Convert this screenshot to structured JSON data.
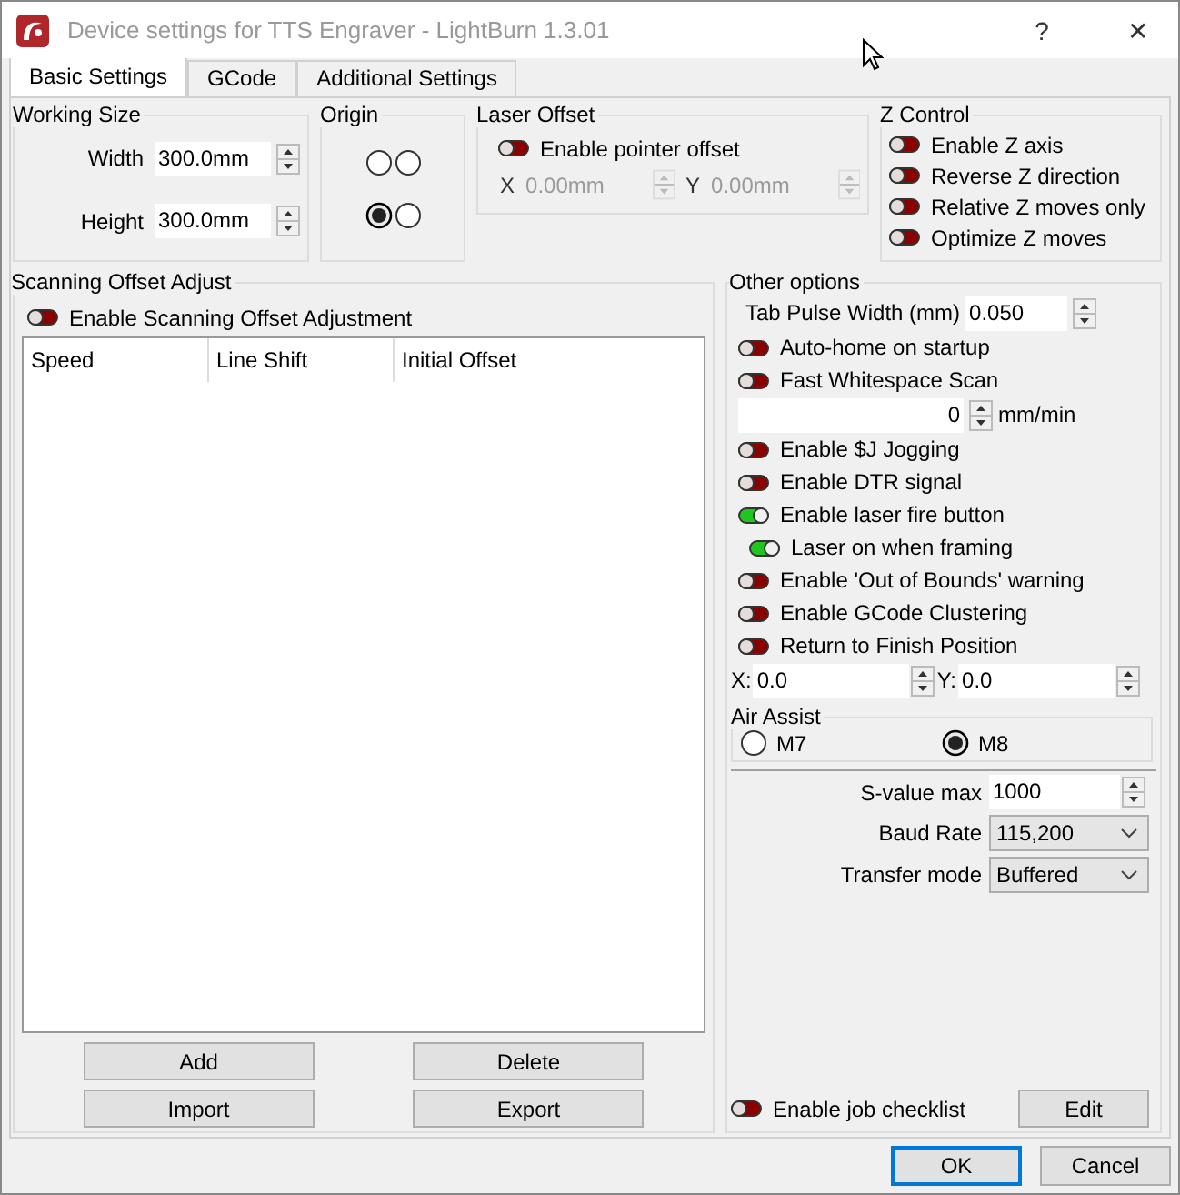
{
  "window": {
    "title": "Device settings for TTS Engraver - LightBurn 1.3.01",
    "help": "?",
    "close": "✕"
  },
  "tabs": [
    {
      "label": "Basic Settings",
      "selected": true
    },
    {
      "label": "GCode",
      "selected": false
    },
    {
      "label": "Additional Settings",
      "selected": false
    }
  ],
  "working_size": {
    "title": "Working Size",
    "fields": [
      {
        "label": "Width",
        "value": "300.0mm"
      },
      {
        "label": "Height",
        "value": "300.0mm"
      }
    ]
  },
  "origin": {
    "title": "Origin",
    "options": [
      {
        "selected": false
      },
      {
        "selected": false
      },
      {
        "selected": true
      },
      {
        "selected": false
      }
    ]
  },
  "laser_offset": {
    "title": "Laser Offset",
    "toggle": {
      "label": "Enable pointer offset",
      "on": false
    },
    "disabled": true,
    "fields": [
      {
        "label": "X",
        "value": "0.00mm"
      },
      {
        "label": "Y",
        "value": "0.00mm"
      }
    ]
  },
  "z_control": {
    "title": "Z Control",
    "toggles": [
      {
        "label": "Enable Z axis",
        "on": false
      },
      {
        "label": "Reverse Z direction",
        "on": false
      },
      {
        "label": "Relative Z moves only",
        "on": false
      },
      {
        "label": "Optimize Z moves",
        "on": false
      }
    ]
  },
  "scanning": {
    "title": "Scanning Offset Adjust",
    "toggle": {
      "label": "Enable Scanning Offset Adjustment",
      "on": false
    },
    "columns": [
      "Speed",
      "Line Shift",
      "Initial Offset"
    ],
    "buttons": [
      "Add",
      "Delete",
      "Import",
      "Export"
    ]
  },
  "other_options": {
    "title": "Other options",
    "items": [
      {
        "kind": "spin",
        "label": "Tab Pulse Width (mm)",
        "value": "0.050"
      },
      {
        "kind": "toggle",
        "label": "Auto-home on startup",
        "on": false
      },
      {
        "kind": "toggle",
        "label": "Fast Whitespace Scan",
        "on": false
      },
      {
        "kind": "unit",
        "value": "0",
        "unit": "mm/min"
      },
      {
        "kind": "toggle",
        "label": "Enable $J Jogging",
        "on": false
      },
      {
        "kind": "toggle",
        "label": "Enable DTR signal",
        "on": false
      },
      {
        "kind": "toggle",
        "label": "Enable laser fire button",
        "on": true,
        "children": [
          {
            "kind": "toggle",
            "label": "Laser on when framing",
            "on": true
          }
        ]
      },
      {
        "kind": "toggle",
        "label": "Enable 'Out of Bounds' warning",
        "on": false
      },
      {
        "kind": "toggle",
        "label": "Enable GCode Clustering",
        "on": false
      },
      {
        "kind": "toggle",
        "label": "Return to Finish Position",
        "on": false
      },
      {
        "kind": "xy",
        "fields": [
          {
            "label": "X:",
            "value": "0.0"
          },
          {
            "label": "Y:",
            "value": "0.0"
          }
        ]
      }
    ],
    "air_assist": {
      "title": "Air Assist",
      "options": [
        {
          "label": "M7",
          "selected": false
        },
        {
          "label": "M8",
          "selected": true
        }
      ]
    },
    "settings": [
      {
        "kind": "spin",
        "label": "S-value max",
        "value": "1000"
      },
      {
        "kind": "combo",
        "label": "Baud Rate",
        "value": "115,200"
      },
      {
        "kind": "combo",
        "label": "Transfer mode",
        "value": "Buffered"
      }
    ],
    "checklist": {
      "label": "Enable job checklist",
      "on": false
    },
    "edit_button": "Edit"
  },
  "footer": [
    {
      "label": "OK",
      "default": true
    },
    {
      "label": "Cancel",
      "default": false
    }
  ]
}
